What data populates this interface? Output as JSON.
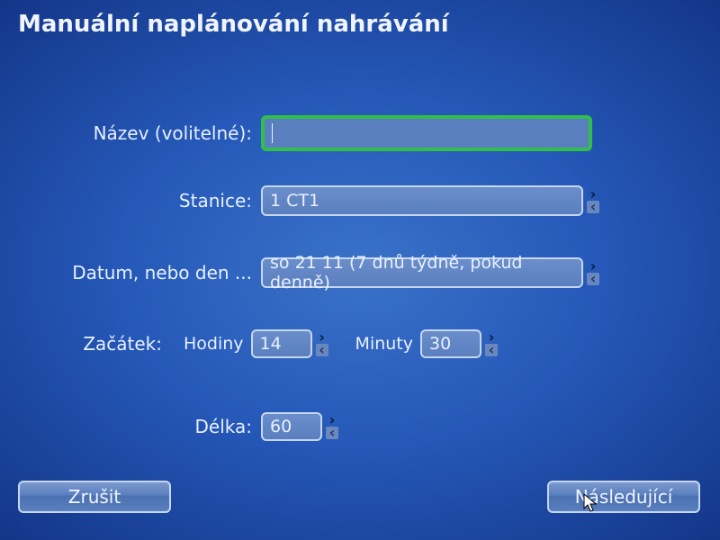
{
  "title": "Manuální naplánování nahrávání",
  "fields": {
    "name": {
      "label": "Název (volitelné):",
      "value": ""
    },
    "channel": {
      "label": "Stanice:",
      "value": "1 CT1"
    },
    "date": {
      "label": "Datum, nebo den ...",
      "value": "so 21 11 (7 dnů týdně, pokud denně)"
    },
    "start": {
      "label": "Začátek:"
    },
    "hours": {
      "label": "Hodiny",
      "value": "14"
    },
    "minutes": {
      "label": "Minuty",
      "value": "30"
    },
    "length": {
      "label": "Délka:",
      "value": "60"
    }
  },
  "buttons": {
    "cancel": "Zrušit",
    "next": "Následující"
  }
}
